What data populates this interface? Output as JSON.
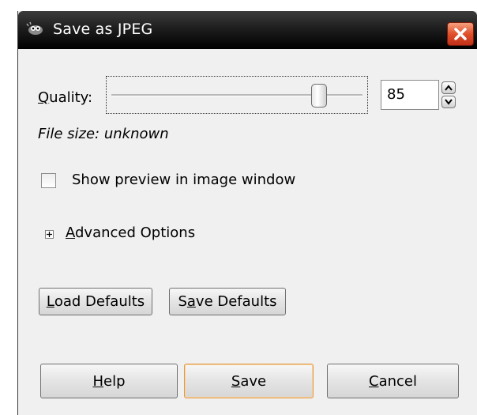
{
  "window": {
    "title": "Save as JPEG",
    "app_icon": "gimp-icon",
    "close_icon": "close-icon"
  },
  "quality": {
    "label": "Quality:",
    "label_mnemonic": "Q",
    "label_rest": "uality:",
    "value": "85",
    "slider_fraction": 0.85
  },
  "file_size": {
    "text": "File size: unknown"
  },
  "preview": {
    "label": "Show preview in image window",
    "checked": false
  },
  "advanced": {
    "label": "Advanced Options",
    "mnemonic": "A",
    "rest": "dvanced Options",
    "expander_icon": "plus-icon"
  },
  "defaults": {
    "load": {
      "label": "Load Defaults",
      "mnemonic": "L",
      "rest": "oad Defaults"
    },
    "save": {
      "label": "Save Defaults",
      "pre": "S",
      "mnemonic": "a",
      "rest": "ve Defaults"
    }
  },
  "actions": {
    "help": {
      "label": "Help",
      "mnemonic": "H",
      "rest": "elp"
    },
    "save": {
      "label": "Save",
      "mnemonic": "S",
      "rest": "ave"
    },
    "cancel": {
      "label": "Cancel",
      "mnemonic": "C",
      "rest": "ancel"
    }
  },
  "colors": {
    "titlebar": "#000000",
    "close_button": "#e0502a",
    "dialog_bg": "#f0f0f0",
    "default_button_border": "#e29a48"
  }
}
